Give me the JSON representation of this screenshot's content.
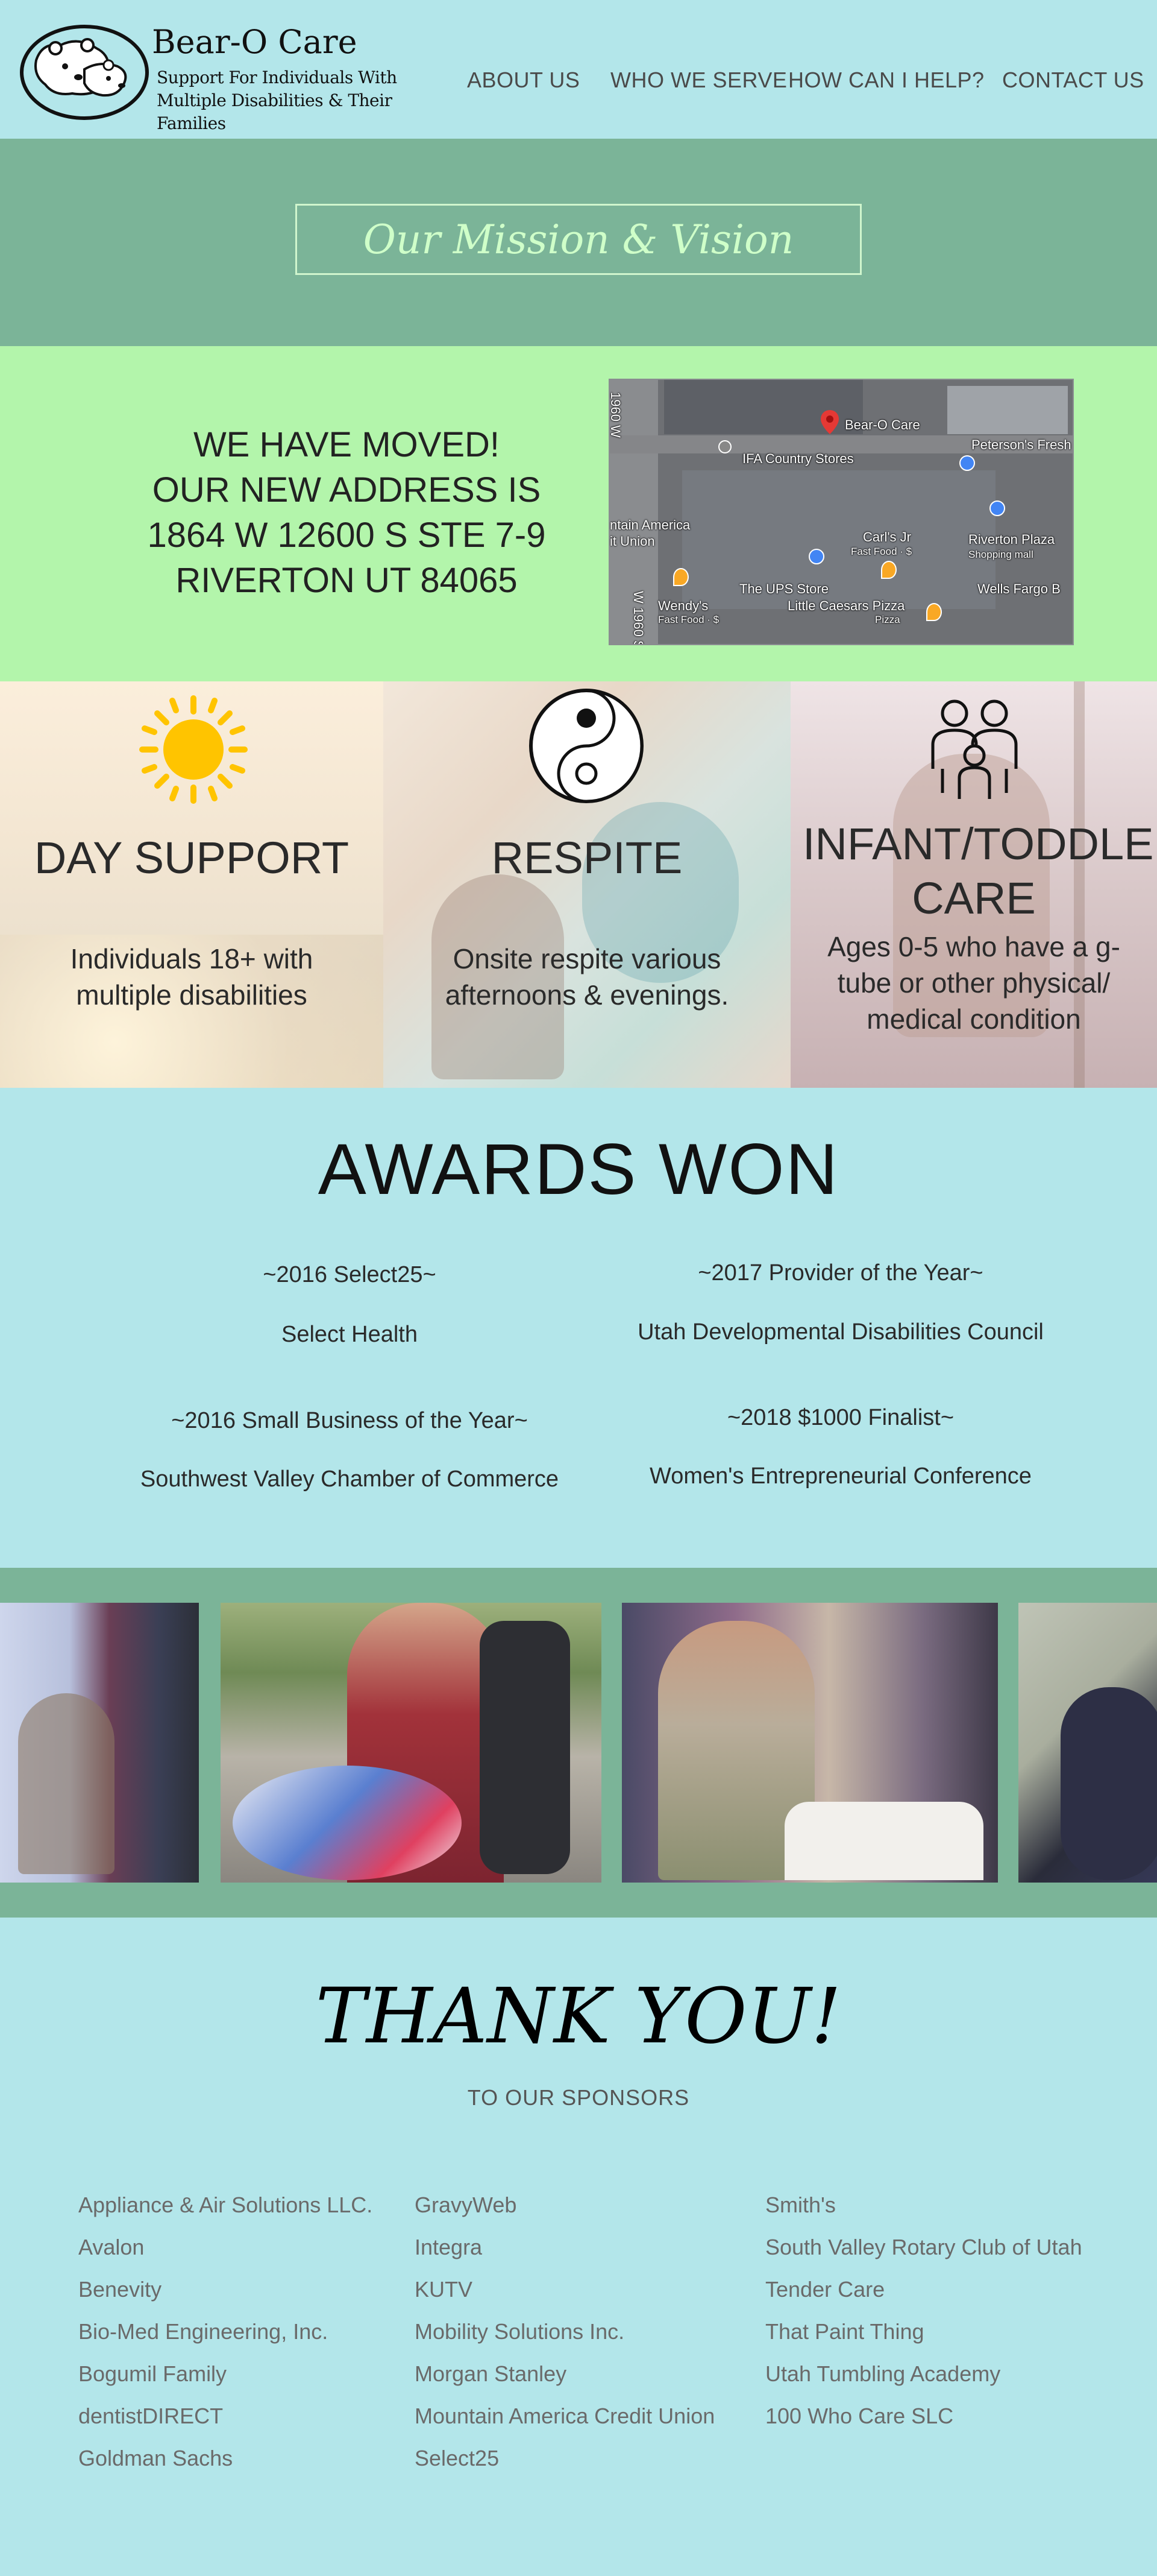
{
  "header": {
    "brand_name": "Bear-O Care",
    "tagline": "Support For Individuals With Multiple Disabilities & Their Families",
    "nav": [
      {
        "label": "ABOUT US"
      },
      {
        "label": "WHO WE SERVE"
      },
      {
        "label": "HOW CAN I HELP?"
      },
      {
        "label": "CONTACT US"
      }
    ]
  },
  "mission": {
    "button_label": "Our Mission & Vision"
  },
  "moved": {
    "lines": [
      "WE HAVE MOVED!",
      "OUR NEW ADDRESS IS",
      "1864 W 12600 S STE 7-9",
      "RIVERTON UT 84065"
    ]
  },
  "map": {
    "labels": {
      "pin": "Bear-O Care",
      "country_stores": "IFA Country Stores",
      "petersons": "Peterson's Fresh M",
      "mountain_america": "ntain America",
      "credit_union": "it Union",
      "carls": "Carl's Jr",
      "carls_sub": "Fast Food · $",
      "riverton_plaza": "Riverton Plaza",
      "riverton_plaza_sub": "Shopping mall",
      "ups": "The UPS Store",
      "wendys": "Wendy's",
      "wendys_sub": "Fast Food · $",
      "little_caesars": "Little Caesars Pizza",
      "little_caesars_sub": "Pizza",
      "wells_fargo": "Wells Fargo B",
      "road_1": "1960 W",
      "road_2": "W 1960 S"
    }
  },
  "services": [
    {
      "title": "DAY SUPPORT",
      "desc": "Individuals 18+ with multiple disabilities",
      "icon": "sun-icon"
    },
    {
      "title": "RESPITE",
      "desc": "Onsite respite various afternoons & evenings.",
      "icon": "yin-yang-icon"
    },
    {
      "title": "INFANT/TODDLER CARE",
      "desc": "Ages 0-5 who have a g-tube or other physical/ medical condition",
      "icon": "family-icon"
    }
  ],
  "awards": {
    "title": "AWARDS WON",
    "items": [
      {
        "year": "~2016 Select25~",
        "org": "Select Health"
      },
      {
        "year": "~2017 Provider of the Year~",
        "org": "Utah Developmental Disabilities Council"
      },
      {
        "year": "~2016 Small Business of the Year~",
        "org": "Southwest Valley Chamber of Commerce"
      },
      {
        "year": "~2018 $1000 Finalist~",
        "org": "Women's Entrepreneurial Conference"
      }
    ]
  },
  "sponsors": {
    "title": "THANK YOU!",
    "subtitle": "TO OUR SPONSORS",
    "columns": [
      [
        "Appliance & Air Solutions LLC.",
        "Avalon",
        "Benevity",
        "Bio-Med Engineering, Inc.",
        "Bogumil Family",
        "dentistDIRECT",
        "Goldman Sachs"
      ],
      [
        "GravyWeb",
        "Integra",
        "KUTV",
        "Mobility Solutions Inc.",
        "Morgan Stanley",
        "Mountain America Credit Union",
        "Select25"
      ],
      [
        "Smith's",
        "South Valley Rotary Club of Utah",
        "Tender Care",
        "That Paint Thing",
        "Utah Tumbling Academy",
        "100 Who Care SLC"
      ]
    ]
  },
  "colors": {
    "page_bg": "#b3e6ea",
    "mission_bg": "#7bb498",
    "moved_bg": "#b3f5ab",
    "mission_text": "#cfffc9",
    "sun": "#ffc400"
  }
}
